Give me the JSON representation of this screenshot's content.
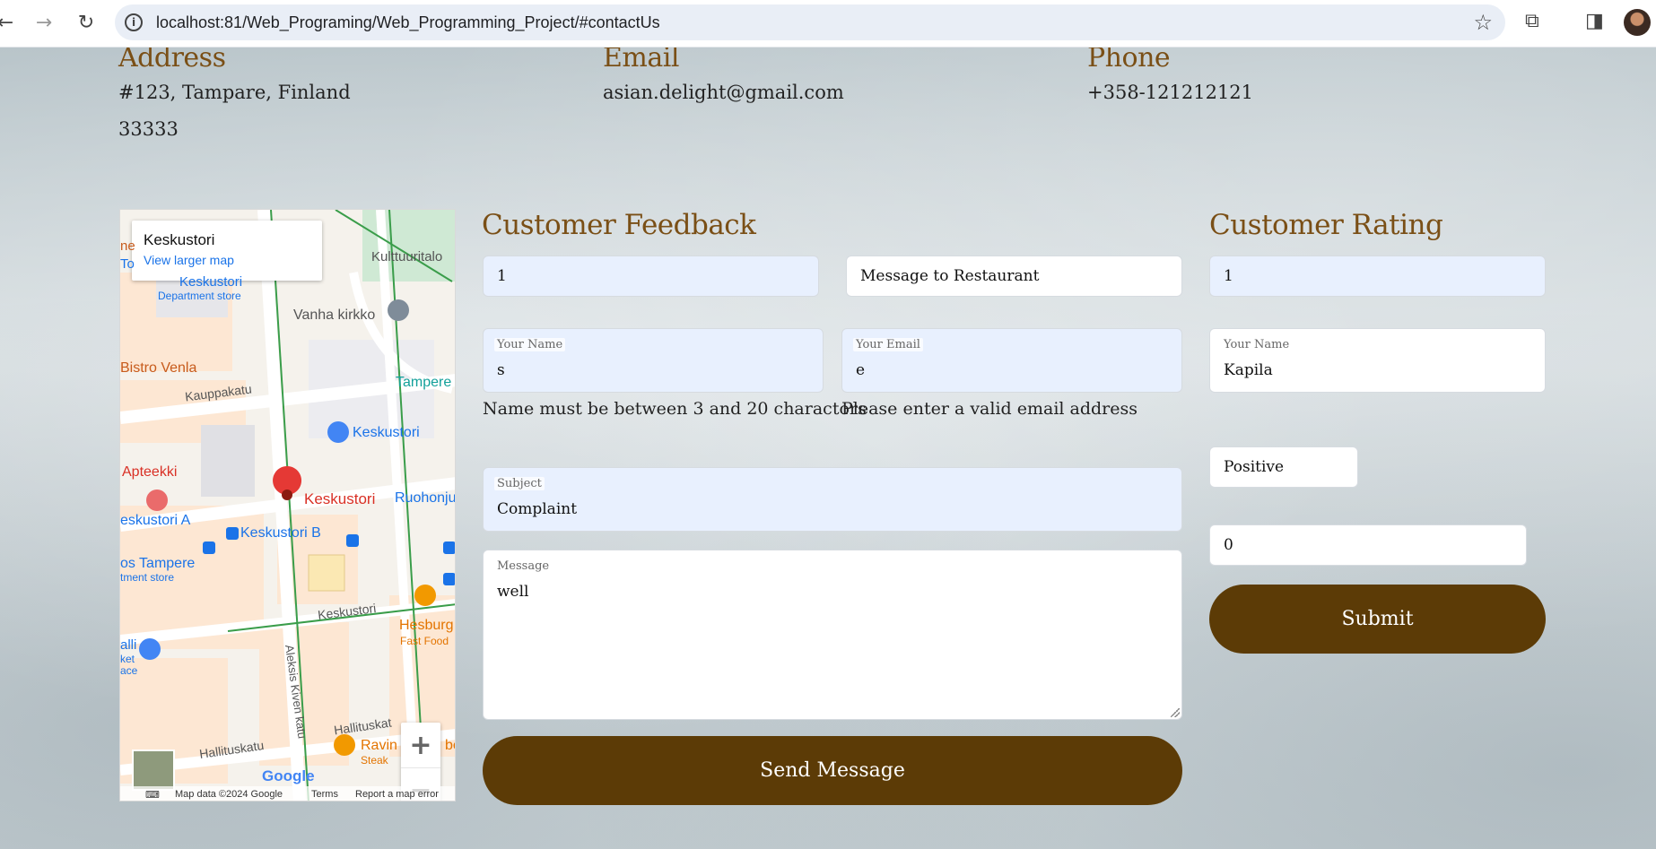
{
  "browser": {
    "url": "localhost:81/Web_Programing/Web_Programming_Project/#contactUs",
    "back_icon": "arrow-left-icon",
    "forward_icon": "arrow-right-icon",
    "reload_icon": "reload-icon"
  },
  "contact": {
    "address_title": "Address",
    "address_line1": "#123, Tampare, Finland",
    "address_line2": "33333",
    "email_title": "Email",
    "email_value": "asian.delight@gmail.com",
    "phone_title": "Phone",
    "phone_value": "+358-121212121"
  },
  "map": {
    "place_title": "Keskustori",
    "larger_map_link": "View larger map",
    "labels": {
      "kulttuuritalo": "Kulttuuritalo",
      "keskustori_dept": "Keskustori",
      "department_store": "Department store",
      "vanha_kirkko": "Vanha kirkko",
      "bistro": "Bistro Venla",
      "tampere": "Tampere",
      "kauppakatu": "Kauppakatu",
      "keskustori_poi": "Keskustori",
      "apteekki": "Apteekki",
      "keskustori_pin": "Keskustori",
      "ruohonju": "Ruohonju",
      "keskustori_a": "eskustori A",
      "keskustori_b": "Keskustori B",
      "sos_tampere": "os Tampere",
      "tment_store": "tment store",
      "keskuskatu": "Keskustori",
      "hesburger": "Hesburg",
      "fast_food": "Fast Food",
      "aleksis": "Aleksis Kiven katu",
      "hallituskatu1": "Hallituskat",
      "hallituskatu2": "Hallituskatu",
      "ravintola": "Ravin",
      "steak": "Steak",
      "alli": "alli",
      "ket": "ket",
      "ace": "ace",
      "left_cut": "ne",
      "left_cut2": "To",
      "be": "be"
    },
    "zoom_in": "+",
    "zoom_out": "−",
    "google": "Google",
    "footer_data": "Map data ©2024 Google",
    "footer_terms": "Terms",
    "footer_report": "Report a map error"
  },
  "feedback": {
    "title": "Customer Feedback",
    "id_value": "1",
    "type_value": "Message to Restaurant",
    "name_label": "Your Name",
    "name_value": "s",
    "email_label": "Your Email",
    "email_value": "e",
    "name_error": "Name must be between 3 and 20 charactors",
    "email_error": "Please enter a valid email address",
    "subject_label": "Subject",
    "subject_value": "Complaint",
    "message_label": "Message",
    "message_value": "well",
    "send_button": "Send Message"
  },
  "rating": {
    "title": "Customer Rating",
    "id_value": "1",
    "name_label": "Your Name",
    "name_value": "Kapila",
    "sentiment_value": "Positive",
    "score_value": "0",
    "submit_button": "Submit"
  }
}
